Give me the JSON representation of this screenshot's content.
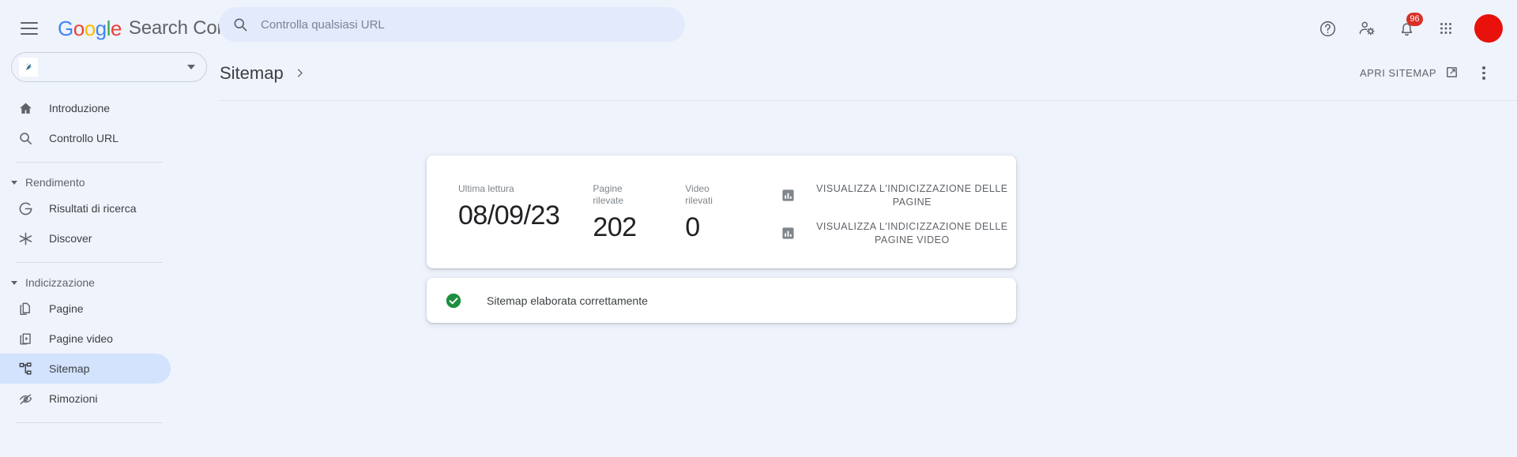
{
  "topbar": {
    "menu_icon": "hamburger-menu-icon",
    "logo_text": "Google",
    "product_name": "Search Console",
    "search": {
      "icon": "search-icon",
      "placeholder": "Controlla qualsiasi URL",
      "value": ""
    },
    "help_icon": "help-circle-icon",
    "account_settings_icon": "person-gear-icon",
    "notifications_icon": "bell-icon",
    "notifications_count": "96",
    "apps_icon": "apps-grid-icon",
    "avatar": "user-avatar",
    "colors": {
      "bar_bg": "#eff3fc",
      "search_bg": "#e3eafc",
      "badge": "#d93025",
      "avatar": "#e8110b"
    }
  },
  "sidebar": {
    "property_selector": {
      "favicon": "site-favicon",
      "label": "",
      "caret_icon": "chevron-down-icon"
    },
    "items": [
      {
        "label": "Introduzione",
        "icon": "home-icon",
        "active": false
      },
      {
        "label": "Controllo URL",
        "icon": "search-icon",
        "active": false
      }
    ],
    "groups": [
      {
        "label": "Rendimento",
        "caret_icon": "triangle-down-icon",
        "items": [
          {
            "label": "Risultati di ricerca",
            "icon": "google-g-icon",
            "active": false
          },
          {
            "label": "Discover",
            "icon": "discover-asterisk-icon",
            "active": false
          }
        ]
      },
      {
        "label": "Indicizzazione",
        "caret_icon": "triangle-down-icon",
        "items": [
          {
            "label": "Pagine",
            "icon": "pages-copy-icon",
            "active": false
          },
          {
            "label": "Pagine video",
            "icon": "video-page-icon",
            "active": false
          },
          {
            "label": "Sitemap",
            "icon": "sitemap-tree-icon",
            "active": true
          },
          {
            "label": "Rimozioni",
            "icon": "eye-off-icon",
            "active": false
          }
        ]
      }
    ],
    "active_color": "#d3e2fd"
  },
  "header": {
    "breadcrumb_title": "Sitemap",
    "breadcrumb_separator_icon": "chevron-right-icon",
    "breadcrumb_current": "",
    "open_sitemap_label": "APRI SITEMAP",
    "open_sitemap_icon": "external-link-icon",
    "more_menu_icon": "more-vertical-icon"
  },
  "summary_card": {
    "stats": [
      {
        "label": "Ultima lettura",
        "value": "08/09/23",
        "name": "last-read"
      },
      {
        "label": "Pagine rilevate",
        "value": "202",
        "name": "pages-discovered"
      },
      {
        "label": "Video rilevati",
        "value": "0",
        "name": "videos-discovered"
      }
    ],
    "actions": [
      {
        "label": "VISUALIZZA L'INDICIZZAZIONE DELLE PAGINE",
        "icon": "bar-chart-icon"
      },
      {
        "label": "VISUALIZZA L'INDICIZZAZIONE DELLE PAGINE VIDEO",
        "icon": "bar-chart-icon"
      }
    ]
  },
  "status_card": {
    "icon": "check-circle-icon",
    "icon_color": "#1e8e3e",
    "text": "Sitemap elaborata correttamente"
  }
}
